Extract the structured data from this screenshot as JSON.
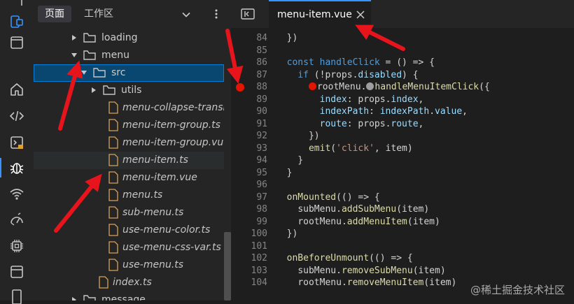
{
  "sidebar": {
    "tabs": [
      {
        "label": "页面"
      },
      {
        "label": "工作区"
      }
    ],
    "tree": [
      {
        "label": "loading",
        "kind": "folder",
        "expanded": false
      },
      {
        "label": "menu",
        "kind": "folder",
        "expanded": true
      },
      {
        "label": "src",
        "kind": "folder",
        "expanded": true,
        "selected": true
      },
      {
        "label": "utils",
        "kind": "folder",
        "expanded": false
      },
      {
        "label": "menu-collapse-transi",
        "kind": "file"
      },
      {
        "label": "menu-item-group.ts",
        "kind": "file"
      },
      {
        "label": "menu-item-group.vue",
        "kind": "file"
      },
      {
        "label": "menu-item.ts",
        "kind": "file",
        "hover": true
      },
      {
        "label": "menu-item.vue",
        "kind": "file"
      },
      {
        "label": "menu.ts",
        "kind": "file"
      },
      {
        "label": "sub-menu.ts",
        "kind": "file"
      },
      {
        "label": "use-menu-color.ts",
        "kind": "file"
      },
      {
        "label": "use-menu-css-var.ts",
        "kind": "file"
      },
      {
        "label": "use-menu.ts",
        "kind": "file"
      },
      {
        "label": "index.ts",
        "kind": "file"
      },
      {
        "label": "message",
        "kind": "folder",
        "expanded": false
      }
    ]
  },
  "editor": {
    "tab_label": "menu-item.vue",
    "line_numbers": [
      "84",
      "85",
      "86",
      "87",
      "88",
      "89",
      "90",
      "91",
      "92",
      "93",
      "94",
      "95",
      "96",
      "97",
      "98",
      "99",
      "100",
      "101",
      "102",
      "103",
      "104"
    ],
    "breakpoint_line": "88",
    "code": [
      "  })",
      "",
      "  const handleClick = () => {",
      "    if (!props.disabled) {",
      "      ●rootMenu.●handleMenuItemClick({",
      "        index: props.index,",
      "        indexPath: indexPath.value,",
      "        route: props.route,",
      "      })",
      "      emit('click', item)",
      "    }",
      "  }",
      "",
      "  onMounted(() => {",
      "    subMenu.addSubMenu(item)",
      "    rootMenu.addMenuItem(item)",
      "  })",
      "",
      "  onBeforeUnmount(() => {",
      "    subMenu.removeSubMenu(item)",
      "    rootMenu.removeMenuItem(item)"
    ]
  },
  "watermark": "@稀土掘金技术社区",
  "colors": {
    "accent": "#3794ff",
    "breakpoint": "#e51400",
    "annotation_arrow": "#e8141c",
    "selection": "#094771",
    "folder_icon": "#c5c5c5",
    "file_icon": "#d7a15a"
  },
  "activity_icons": [
    "run-debug-icon",
    "remote-explorer-icon",
    "window-icon",
    "home-icon",
    "code-icon",
    "terminal-icon",
    "bug-icon",
    "wifi-icon",
    "performance-icon",
    "chip-icon",
    "panel-icon",
    "document-icon"
  ]
}
